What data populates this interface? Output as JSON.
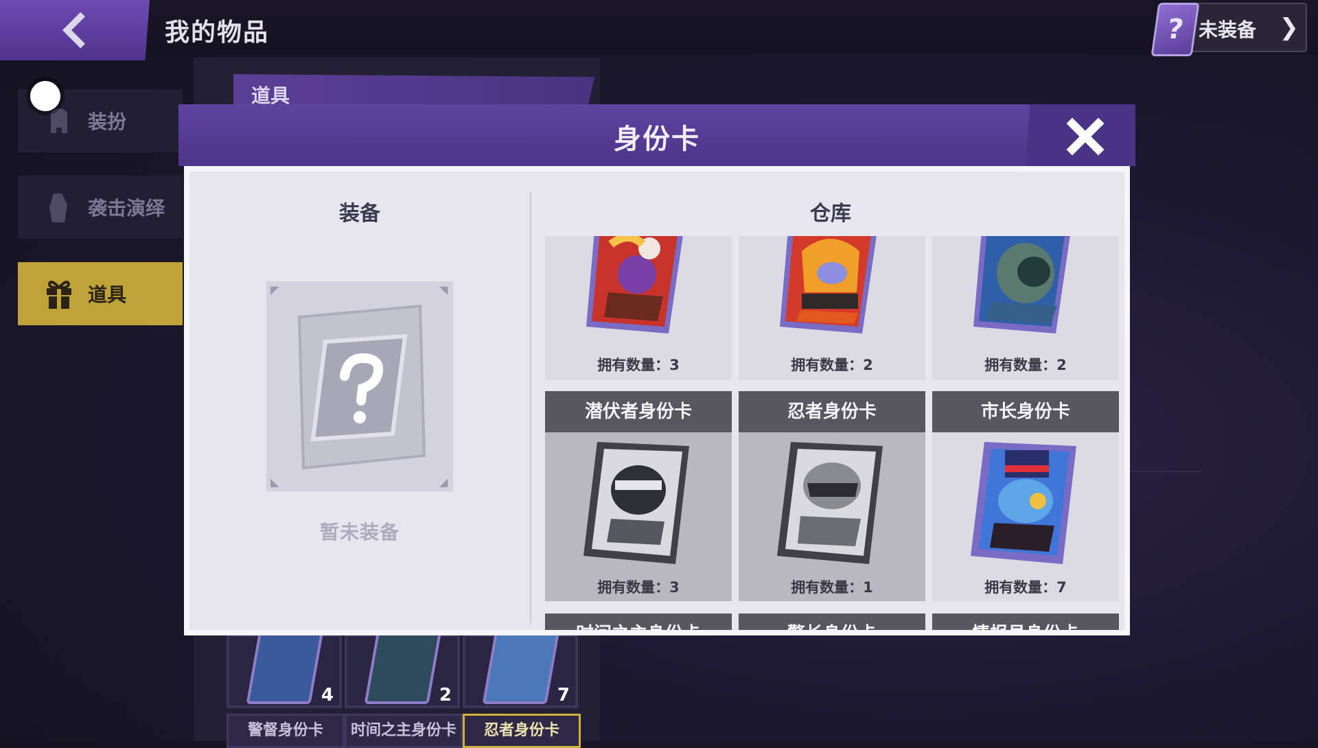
{
  "header": {
    "title": "我的物品",
    "equip_status": "未装备",
    "equip_chip_icon": "?"
  },
  "sidebar": {
    "items": [
      {
        "label": "装扮",
        "icon": "costume-icon"
      },
      {
        "label": "袭击演绎",
        "icon": "attack-icon"
      },
      {
        "label": "道具",
        "icon": "gift-icon",
        "active": true
      }
    ]
  },
  "background": {
    "tab": "道具",
    "cards": [
      {
        "count": "4"
      },
      {
        "count": "2"
      },
      {
        "count": "7"
      }
    ],
    "names": [
      "警督身份卡",
      "时间之主身份卡",
      "忍者身份卡"
    ]
  },
  "modal": {
    "title": "身份卡",
    "equip": {
      "title": "装备",
      "empty_text": "暂未装备"
    },
    "warehouse": {
      "title": "仓库",
      "row1": [
        {
          "count_label": "拥有数量：3",
          "theme": "red",
          "owned": true
        },
        {
          "count_label": "拥有数量：2",
          "theme": "red",
          "owned": true
        },
        {
          "count_label": "拥有数量：2",
          "theme": "blue",
          "owned": true
        }
      ],
      "row2": [
        {
          "name": "潜伏者身份卡",
          "count_label": "拥有数量：3",
          "owned": false
        },
        {
          "name": "忍者身份卡",
          "count_label": "拥有数量：1",
          "owned": false
        },
        {
          "name": "市长身份卡",
          "count_label": "拥有数量：7",
          "owned": true
        }
      ],
      "row3_partial": [
        "时间之主身份卡",
        "警长身份卡",
        "情报员身份卡"
      ]
    }
  },
  "colors": {
    "accent_purple": "#5e43a0",
    "active_gold": "#bfa238",
    "panel_bg": "#e7e6ee"
  }
}
